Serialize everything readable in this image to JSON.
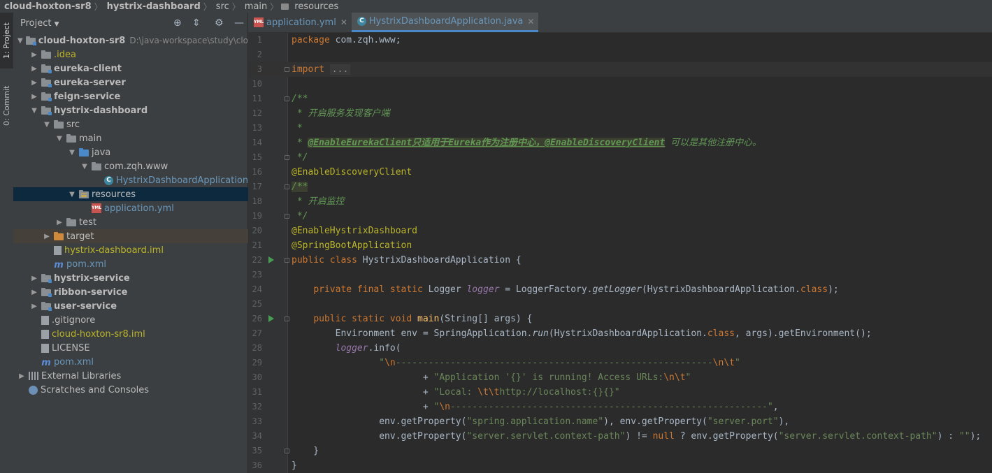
{
  "breadcrumb": [
    "cloud-hoxton-sr8",
    "hystrix-dashboard",
    "src",
    "main",
    "resources"
  ],
  "toolwindow_tabs": {
    "project": "1: Project",
    "commit": "0: Commit"
  },
  "project_panel": {
    "title": "Project",
    "tree": [
      {
        "indent": 0,
        "arrow": "down",
        "icon": "module",
        "label": "cloud-hoxton-sr8",
        "style": "bold",
        "path": "D:\\java-workspace\\study\\cloud"
      },
      {
        "indent": 1,
        "arrow": "right",
        "icon": "folder",
        "label": ".idea",
        "style": "yellow"
      },
      {
        "indent": 1,
        "arrow": "right",
        "icon": "module",
        "label": "eureka-client",
        "style": "bold"
      },
      {
        "indent": 1,
        "arrow": "right",
        "icon": "module",
        "label": "eureka-server",
        "style": "bold"
      },
      {
        "indent": 1,
        "arrow": "right",
        "icon": "module",
        "label": "feign-service",
        "style": "bold"
      },
      {
        "indent": 1,
        "arrow": "down",
        "icon": "module",
        "label": "hystrix-dashboard",
        "style": "bold"
      },
      {
        "indent": 2,
        "arrow": "down",
        "icon": "folder",
        "label": "src",
        "style": ""
      },
      {
        "indent": 3,
        "arrow": "down",
        "icon": "folder",
        "label": "main",
        "style": ""
      },
      {
        "indent": 4,
        "arrow": "down",
        "icon": "folder-blue",
        "label": "java",
        "style": ""
      },
      {
        "indent": 5,
        "arrow": "down",
        "icon": "folder",
        "label": "com.zqh.www",
        "style": ""
      },
      {
        "indent": 6,
        "arrow": "none",
        "icon": "class",
        "label": "HystrixDashboardApplication",
        "style": "modified"
      },
      {
        "indent": 4,
        "arrow": "down",
        "icon": "resources",
        "label": "resources",
        "style": "",
        "selected": true
      },
      {
        "indent": 5,
        "arrow": "none",
        "icon": "yml",
        "label": "application.yml",
        "style": "modified"
      },
      {
        "indent": 3,
        "arrow": "right",
        "icon": "folder",
        "label": "test",
        "style": ""
      },
      {
        "indent": 2,
        "arrow": "right",
        "icon": "folder-orange",
        "label": "target",
        "style": "",
        "excluded": true
      },
      {
        "indent": 2,
        "arrow": "none",
        "icon": "file",
        "label": "hystrix-dashboard.iml",
        "style": "yellow"
      },
      {
        "indent": 2,
        "arrow": "none",
        "icon": "maven",
        "label": "pom.xml",
        "style": "modified"
      },
      {
        "indent": 1,
        "arrow": "right",
        "icon": "module",
        "label": "hystrix-service",
        "style": "bold"
      },
      {
        "indent": 1,
        "arrow": "right",
        "icon": "module",
        "label": "ribbon-service",
        "style": "bold"
      },
      {
        "indent": 1,
        "arrow": "right",
        "icon": "module",
        "label": "user-service",
        "style": "bold"
      },
      {
        "indent": 1,
        "arrow": "none",
        "icon": "file",
        "label": ".gitignore",
        "style": ""
      },
      {
        "indent": 1,
        "arrow": "none",
        "icon": "file",
        "label": "cloud-hoxton-sr8.iml",
        "style": "yellow"
      },
      {
        "indent": 1,
        "arrow": "none",
        "icon": "file",
        "label": "LICENSE",
        "style": ""
      },
      {
        "indent": 1,
        "arrow": "none",
        "icon": "maven",
        "label": "pom.xml",
        "style": "modified"
      },
      {
        "indent": 0,
        "arrow": "right",
        "icon": "lib",
        "label": "External Libraries",
        "style": ""
      },
      {
        "indent": 0,
        "arrow": "none",
        "icon": "scratch",
        "label": "Scratches and Consoles",
        "style": ""
      }
    ]
  },
  "editor_tabs": [
    {
      "label": "application.yml",
      "icon": "yml",
      "active": false
    },
    {
      "label": "HystrixDashboardApplication.java",
      "icon": "class",
      "active": true
    }
  ],
  "code_lines": [
    {
      "n": "1",
      "html": "<span class=\"kw\">package</span> com.zqh.www;"
    },
    {
      "n": "2",
      "html": ""
    },
    {
      "n": "3",
      "html": "<span class=\"kw\">import</span> <span class=\"fold-box\">...</span>",
      "current": true
    },
    {
      "n": "10",
      "html": ""
    },
    {
      "n": "11",
      "html": "<span class=\"doc\">/**</span>"
    },
    {
      "n": "12",
      "html": "<span class=\"doc\"> * 开启服务发现客户端</span>"
    },
    {
      "n": "13",
      "html": "<span class=\"doc\"> *</span>"
    },
    {
      "n": "14",
      "html": "<span class=\"doc\"> * </span><span class=\"doc-hl\">@EnableEurekaClient只适用于Eureka作为注册中心，@EnableDiscoveryClient</span><span class=\"doc\"> 可以是其他注册中心。</span>"
    },
    {
      "n": "15",
      "html": "<span class=\"doc\"> */</span>"
    },
    {
      "n": "16",
      "html": "<span class=\"an\">@EnableDiscoveryClient</span>"
    },
    {
      "n": "17",
      "html": "<span class=\"doc\" style=\"background:#3b3f2f\">/**</span>"
    },
    {
      "n": "18",
      "html": "<span class=\"doc\"> * 开启监控</span>"
    },
    {
      "n": "19",
      "html": "<span class=\"doc\"> */</span>"
    },
    {
      "n": "20",
      "html": "<span class=\"an\">@EnableHystrixDashboard</span>"
    },
    {
      "n": "21",
      "html": "<span class=\"an\">@SpringBootApplication</span>"
    },
    {
      "n": "22",
      "html": "<span class=\"kw\">public class</span> HystrixDashboardApplication {",
      "run": true
    },
    {
      "n": "23",
      "html": ""
    },
    {
      "n": "24",
      "html": "    <span class=\"kw\">private final static</span> Logger <span class=\"fld\">logger</span> = LoggerFactory.<span class=\"it\">getLogger</span>(HystrixDashboardApplication.<span class=\"kw\">class</span>);"
    },
    {
      "n": "25",
      "html": ""
    },
    {
      "n": "26",
      "html": "    <span class=\"kw\">public static void</span> <span class=\"fn\">main</span>(String[] args) {",
      "run": true
    },
    {
      "n": "27",
      "html": "        Environment env = SpringApplication.<span class=\"it\">run</span>(HystrixDashboardApplication.<span class=\"kw\">class</span>, args).getEnvironment();"
    },
    {
      "n": "28",
      "html": "        <span class=\"fld\">logger</span>.info("
    },
    {
      "n": "29",
      "html": "                <span class=\"str\">\"</span><span class=\"esc\">\\n</span><span class=\"str\">----------------------------------------------------------</span><span class=\"esc\">\\n\\t</span><span class=\"str\">\"</span>"
    },
    {
      "n": "30",
      "html": "                        + <span class=\"str\">\"Application '{}' is running! Access URLs:</span><span class=\"esc\">\\n\\t</span><span class=\"str\">\"</span>"
    },
    {
      "n": "31",
      "html": "                        + <span class=\"str\">\"Local: </span><span class=\"esc\">\\t\\t</span><span class=\"str\">http://localhost:{}{}\"</span>"
    },
    {
      "n": "32",
      "html": "                        + <span class=\"str\">\"</span><span class=\"esc\">\\n</span><span class=\"str\">----------------------------------------------------------\"</span>,"
    },
    {
      "n": "33",
      "html": "                env.getProperty(<span class=\"str\">\"spring.application.name\"</span>), env.getProperty(<span class=\"str\">\"server.port\"</span>),"
    },
    {
      "n": "34",
      "html": "                env.getProperty(<span class=\"str\">\"server.servlet.context-path\"</span>) != <span class=\"kw\">null</span> ? env.getProperty(<span class=\"str\">\"server.servlet.context-path\"</span>) : <span class=\"str\">\"\"</span>);"
    },
    {
      "n": "35",
      "html": "    }"
    },
    {
      "n": "36",
      "html": "}"
    }
  ],
  "colors": {
    "accent": "#4a88c7",
    "selection": "#0d293e",
    "keyword": "#cc7832",
    "string": "#6a8759",
    "annotation": "#bbb529",
    "doc": "#629755"
  }
}
